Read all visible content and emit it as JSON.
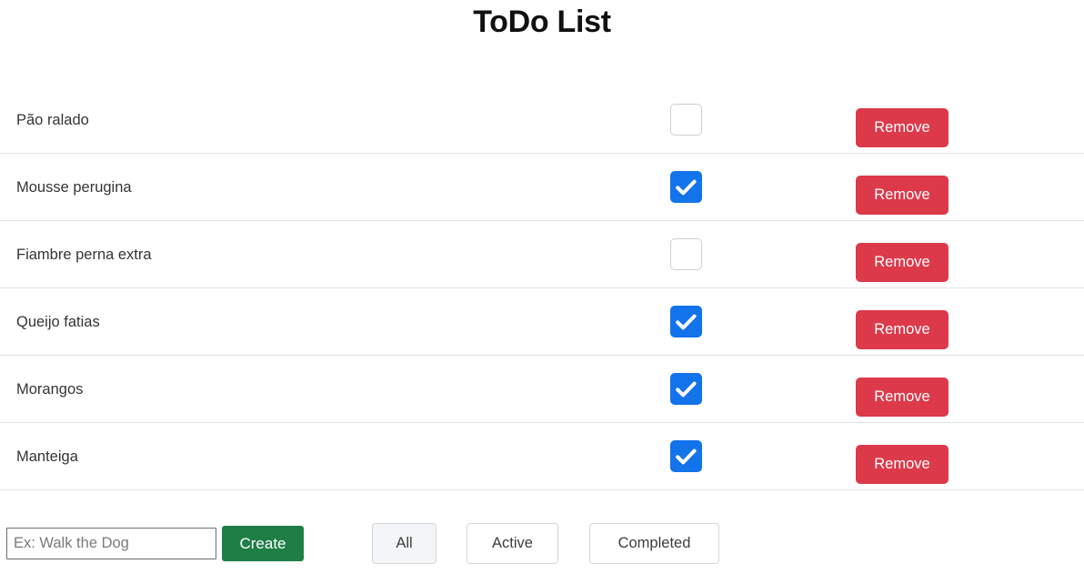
{
  "header": {
    "title": "ToDo List"
  },
  "todos": [
    {
      "label": "Pão ralado",
      "completed": false,
      "remove_label": "Remove"
    },
    {
      "label": "Mousse perugina",
      "completed": true,
      "remove_label": "Remove"
    },
    {
      "label": "Fiambre perna extra",
      "completed": false,
      "remove_label": "Remove"
    },
    {
      "label": "Queijo fatias",
      "completed": true,
      "remove_label": "Remove"
    },
    {
      "label": "Morangos",
      "completed": true,
      "remove_label": "Remove"
    },
    {
      "label": "Manteiga",
      "completed": true,
      "remove_label": "Remove"
    }
  ],
  "controls": {
    "new_todo_placeholder": "Ex: Walk the Dog",
    "new_todo_value": "",
    "create_label": "Create",
    "filters": [
      {
        "id": "all",
        "label": "All",
        "selected": true
      },
      {
        "id": "active",
        "label": "Active",
        "selected": false
      },
      {
        "id": "completed",
        "label": "Completed",
        "selected": false
      }
    ]
  },
  "colors": {
    "checkbox_checked": "#1273eb",
    "remove_button": "#dc3a4b",
    "create_button": "#1e7e45",
    "divider": "#e3e3e3",
    "filter_selected_bg": "#f4f5f6"
  }
}
